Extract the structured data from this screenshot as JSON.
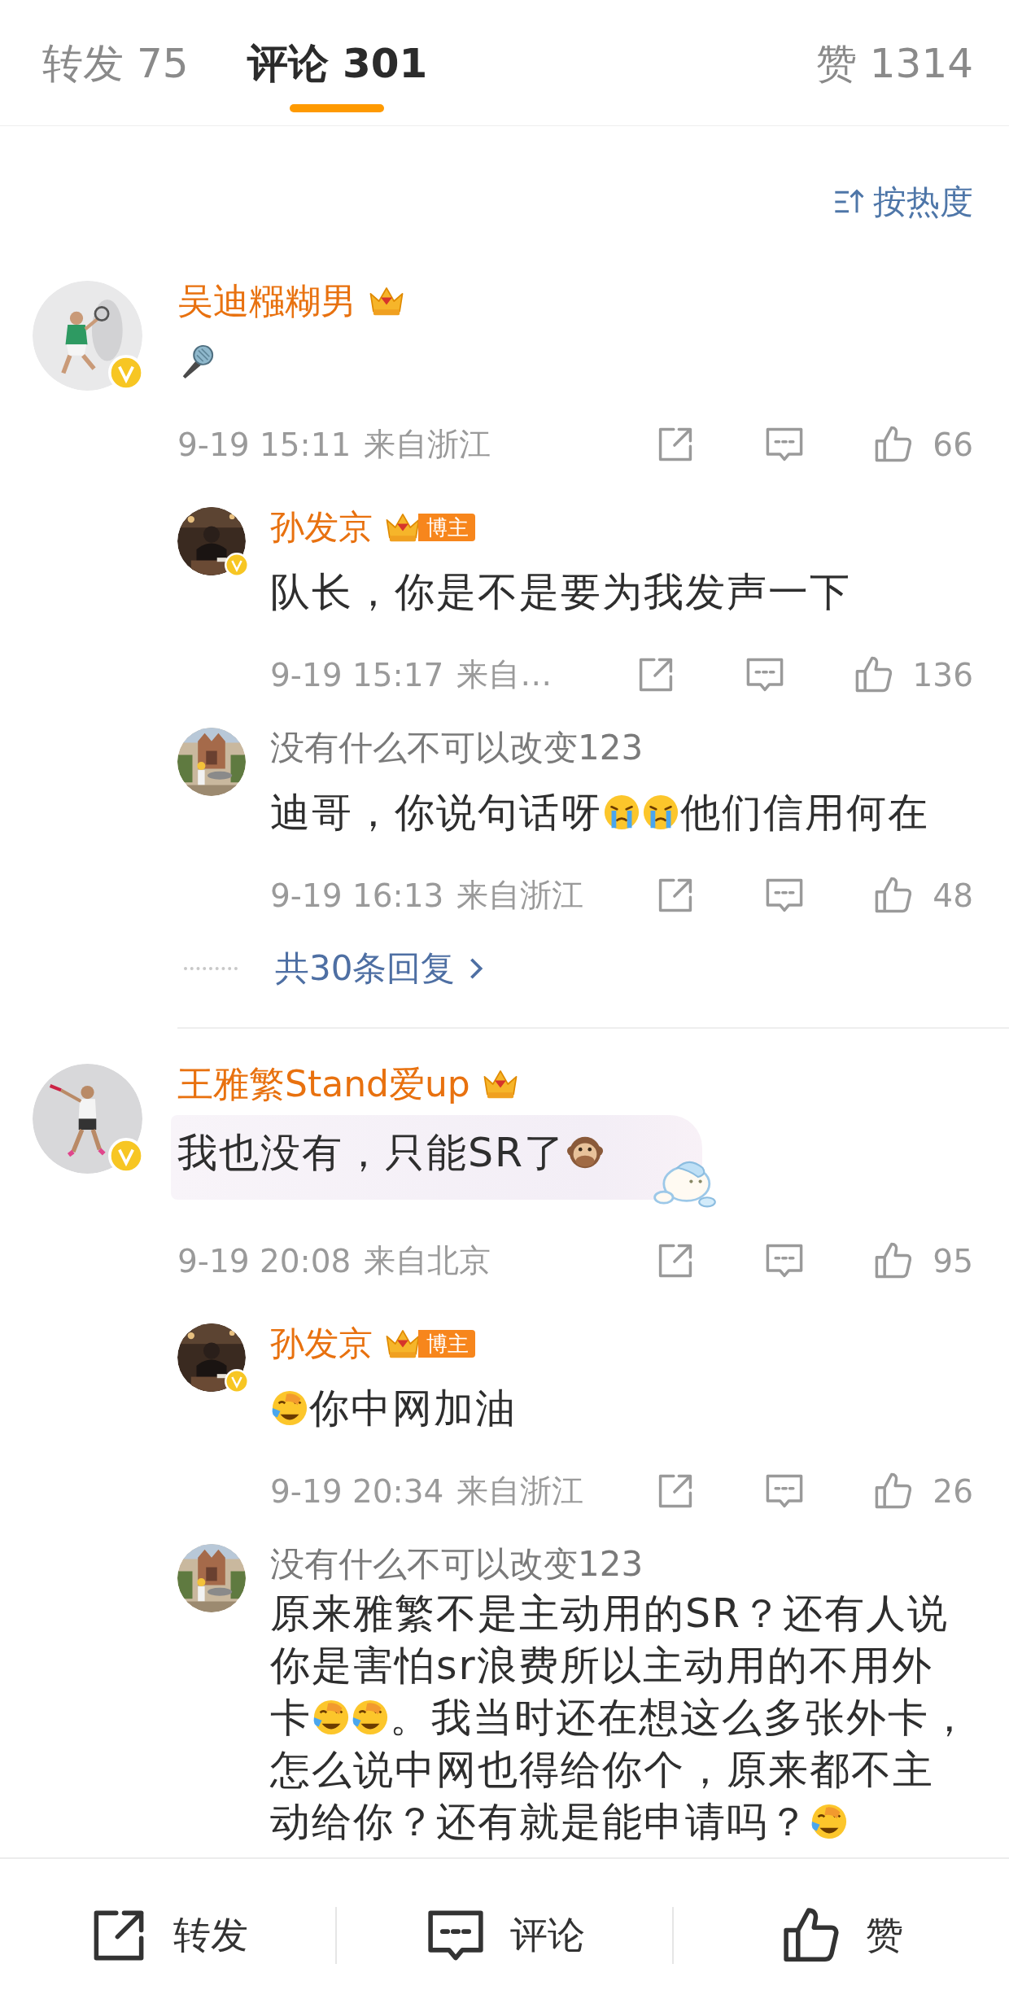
{
  "tabs": [
    {
      "label": "转发 75",
      "selected": false
    },
    {
      "label": "评论 301",
      "selected": true
    },
    {
      "label": "赞 1314",
      "selected": false
    }
  ],
  "sort": {
    "label": "按热度"
  },
  "comments": [
    {
      "user": {
        "name": "吴迪糨糊男",
        "verified": true,
        "badges": [
          {
            "kind": "crown"
          }
        ]
      },
      "content": [
        {
          "kind": "microphone"
        }
      ],
      "time": "9-19 15:11",
      "source": "来自浙江",
      "likes": "66",
      "replies": [
        {
          "user": {
            "name": "孙发京",
            "verified": true,
            "badges": [
              {
                "kind": "crown"
              },
              {
                "kind": "tag",
                "text": "博主"
              }
            ]
          },
          "content": [
            {
              "kind": "text",
              "text": "队长，你是不是要为我发声一下"
            }
          ],
          "time": "9-19 15:17",
          "source": "来自…",
          "likes": "136"
        },
        {
          "user": {
            "name": "没有什么不可以改变123"
          },
          "content": [
            {
              "kind": "text",
              "text": "迪哥，你说句话呀"
            },
            {
              "kind": "crying"
            },
            {
              "kind": "crying"
            },
            {
              "kind": "text",
              "text": "他们信用何在"
            }
          ],
          "time": "9-19 16:13",
          "source": "来自浙江",
          "likes": "48"
        }
      ],
      "more": {
        "label": "共30条回复"
      }
    },
    {
      "user": {
        "name": "王雅繁Stand爱up",
        "verified": true,
        "badges": [
          {
            "kind": "crown"
          }
        ]
      },
      "bubble": true,
      "content": [
        {
          "kind": "text",
          "text": "我也没有，只能SR了"
        },
        {
          "kind": "monkey"
        }
      ],
      "time": "9-19 20:08",
      "source": "来自北京",
      "likes": "95",
      "replies": [
        {
          "user": {
            "name": "孙发京",
            "verified": true,
            "badges": [
              {
                "kind": "crown"
              },
              {
                "kind": "tag",
                "text": "博主"
              }
            ]
          },
          "content": [
            {
              "kind": "laughing"
            },
            {
              "kind": "text",
              "text": "你中网加油"
            }
          ],
          "time": "9-19 20:34",
          "source": "来自浙江",
          "likes": "26"
        },
        {
          "user": {
            "name": "没有什么不可以改变123"
          },
          "content": [
            {
              "kind": "text",
              "text": "原来雅繁不是主动用的SR？还有人说你是害怕sr浪费所以主动用的不用外卡"
            },
            {
              "kind": "laughing"
            },
            {
              "kind": "laughing"
            },
            {
              "kind": "text",
              "text": "。我当时还在想这么多张外卡，怎么说中网也得给你个，原来都不主动给你？还有就是能申请吗？"
            },
            {
              "kind": "laughing"
            }
          ]
        }
      ]
    }
  ],
  "bottom_bar": [
    {
      "kind": "share",
      "label": "转发"
    },
    {
      "kind": "comment",
      "label": "评论"
    },
    {
      "kind": "like",
      "label": "赞"
    }
  ]
}
